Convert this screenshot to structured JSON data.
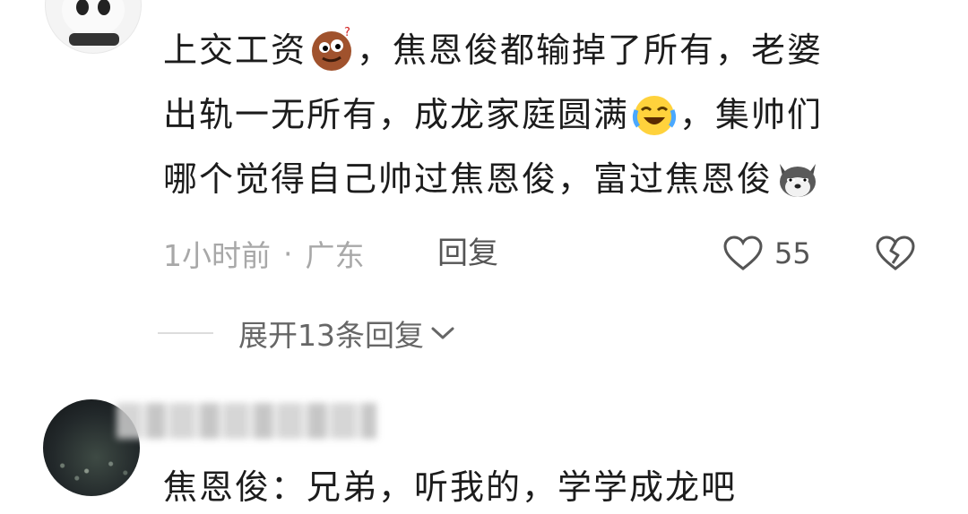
{
  "comment_1": {
    "lines": [
      {
        "before": "上交工资",
        "emoji": "face-emoji",
        "after": "，焦恩俊都输掉了所有，老婆"
      },
      {
        "before": "出轨一无所有，成龙家庭圆满",
        "emoji": "laughing-crying-emoji",
        "after": "，集帅们"
      },
      {
        "before": "哪个觉得自己帅过焦恩俊，富过焦恩俊",
        "emoji": "husky-emoji",
        "after": ""
      }
    ],
    "time": "1小时前",
    "separator": "·",
    "location": "广东",
    "reply_label": "回复",
    "like_count": "55",
    "expand_label": "展开13条回复"
  },
  "comment_2": {
    "text": "焦恩俊：兄弟，听我的，学学成龙吧"
  },
  "colors": {
    "text": "#1c1c1c",
    "meta": "#a8a8a8",
    "action": "#555555"
  }
}
